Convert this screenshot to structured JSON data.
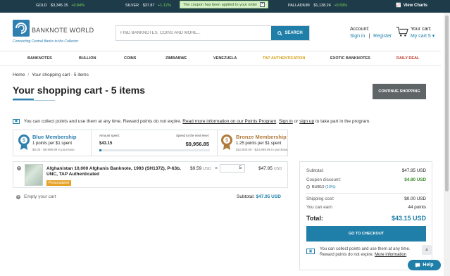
{
  "ticker": {
    "gold_label": "GOLD",
    "gold_price": "$3,345.15",
    "gold_change": "+0.84%",
    "silver_label": "SILVER",
    "silver_price": "$37.87",
    "silver_change": "+1.12%",
    "palladium_label": "PALLADIUM",
    "palladium_price": "$1,138.24",
    "palladium_change": "+0.59%",
    "charts_label": "View Charts"
  },
  "toast": {
    "message": "The coupon has been applied to your order",
    "close": "×"
  },
  "header": {
    "logo_text": "BANKNOTE WORLD",
    "logo_tagline": "Connecting Central Banks to the Collector",
    "search_placeholder": "FIND BANKNOTES, COINS AND MORE...",
    "search_button": "SEARCH",
    "account_label": "Account:",
    "sign_in": "Sign in",
    "register": "Register",
    "cart_label": "Your cart:",
    "cart_link": "My cart 5 ▾"
  },
  "nav": {
    "items": [
      "BANKNOTES",
      "BULLION",
      "COINS",
      "ZIMBABWE",
      "VENEZUELA",
      "TAP AUTHENTICATION",
      "EXOTIC BANKNOTES",
      "DAILY DEAL"
    ]
  },
  "breadcrumb": {
    "home": "Home",
    "current": "Your shopping cart - 5 items"
  },
  "page": {
    "title": "Your shopping cart - 5 items",
    "continue_button": "CONTINUE SHOPPING"
  },
  "points_notice": {
    "text_before": "You can collect points and use them at any time. Reward points do not expire.",
    "link_info": "Read more information on our Points Program",
    "text_sep": ".",
    "sign_in": "Sign in",
    "or": "or",
    "sign_up": "sign up",
    "text_after": "to take part in the program."
  },
  "membership": {
    "current_title": "Blue Membership",
    "current_rate": "1 points per $1 spent",
    "current_range": "$0.00 - $9,999.99 in purchase",
    "amount_label": "Amount spent:",
    "amount_value": "$43.15",
    "next_label": "Spend to the next level:",
    "next_value": "$9,956.85",
    "progress_fraction": 0.0043,
    "next_title": "Bronze Membership",
    "next_rate": "1.25 points per $1 spent",
    "next_range": "$10,000.00 - $24,999.99 in purchase"
  },
  "cart_item": {
    "name": "Afghanistan 10,000 Afghanis Banknote, 1993 (SH1372), P-63b, UNC, TAP Authenticated",
    "tag": "Personalized",
    "price": "$9.59",
    "price_currency": "USD",
    "times": "×",
    "quantity": "5",
    "line_total": "$47.95",
    "line_currency": "USD",
    "remove": "×"
  },
  "cart_footer": {
    "empty_label": "Empty your cart",
    "subtotal_label": "Subtotal:",
    "subtotal_value": "$47.95 USD"
  },
  "summary": {
    "subtotal_label": "Subtotal:",
    "subtotal_value": "$47.95 USD",
    "coupon_label": "Coupon discount:",
    "coupon_value": "$4.80 USD",
    "coupon_code": "BUB10",
    "coupon_pct": "(10%)",
    "shipping_label": "Shipping cost:",
    "shipping_value": "$0.00 USD",
    "earn_label": "You can earn",
    "earn_value": "44 points",
    "total_label": "Total:",
    "total_value": "$43.15 USD",
    "checkout_button": "GO TO CHECKOUT",
    "note_text": "You can collect points and use them at any time. Reward points do not expire.",
    "note_link": "More information"
  },
  "help": {
    "label": "Help"
  },
  "colors": {
    "accent": "#1f7fa8",
    "ticker_bg": "#1e3b4a",
    "toast_bg": "#d6f0c8",
    "deal": "#c0392b",
    "tap": "#d4a017",
    "tag": "#e6a227"
  }
}
